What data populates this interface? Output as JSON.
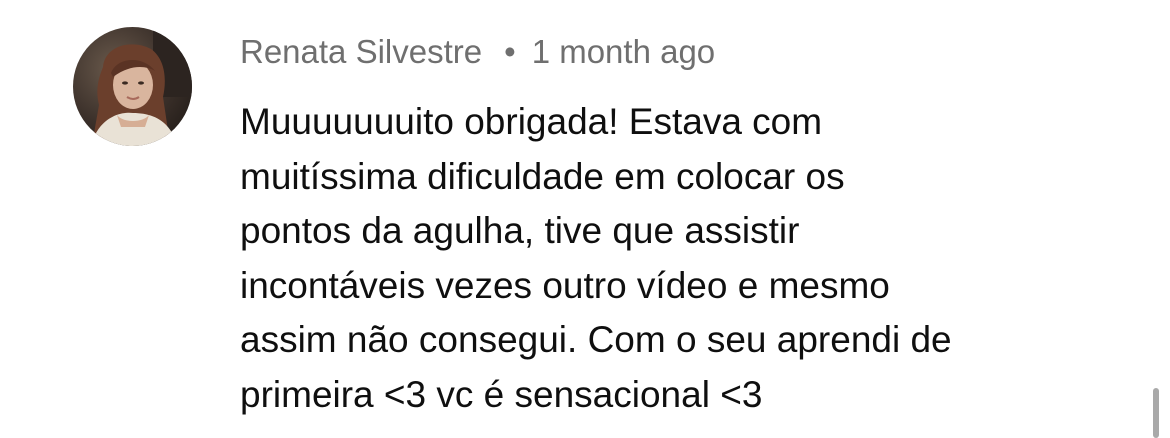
{
  "comment": {
    "author": "Renata Silvestre",
    "separator": "•",
    "time_ago": "1 month ago",
    "text_lines": [
      "Muuuuuuuito obrigada! Estava com",
      "muitíssima dificuldade em colocar os",
      "pontos da agulha, tive que assistir",
      "incontáveis vezes outro vídeo e mesmo",
      "assim não consegui. Com o seu aprendi de",
      "primeira <3 vc é sensacional <3"
    ]
  },
  "colors": {
    "meta_text": "#6f6f6f",
    "body_text": "#0f0f0f",
    "scrollbar": "#a9a9a9"
  }
}
